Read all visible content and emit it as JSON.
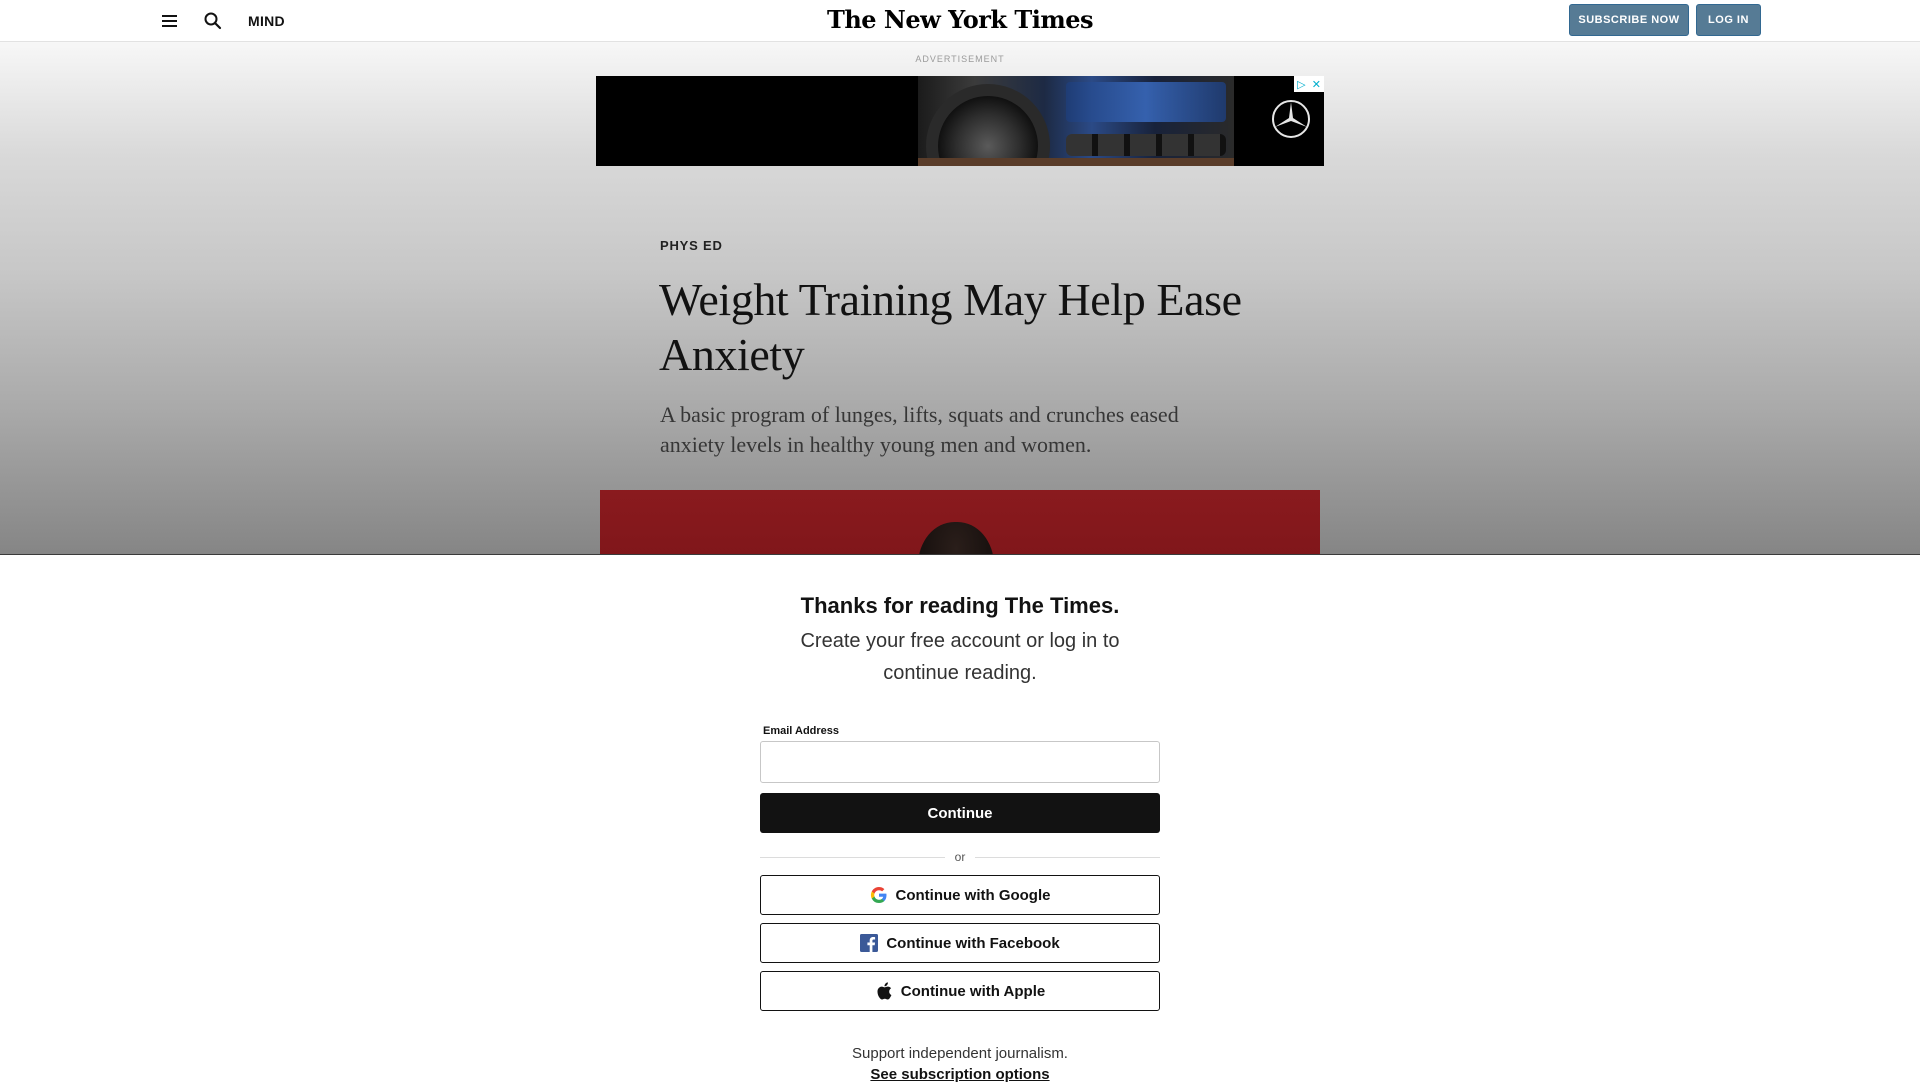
{
  "header": {
    "section": "MIND",
    "masthead": "The New York Times",
    "subscribe_label": "SUBSCRIBE NOW",
    "login_label": "LOG IN"
  },
  "ad": {
    "label": "ADVERTISEMENT"
  },
  "article": {
    "kicker": "PHYS ED",
    "headline": "Weight Training May Help Ease Anxiety",
    "summary": "A basic program of lunges, lifts, squats and crunches eased anxiety levels in healthy young men and women."
  },
  "regwall": {
    "title": "Thanks for reading The Times.",
    "subtitle": "Create your free account or log in to continue reading.",
    "email_label": "Email Address",
    "email_value": "",
    "continue_label": "Continue",
    "or_label": "or",
    "google_label": "Continue with Google",
    "facebook_label": "Continue with Facebook",
    "apple_label": "Continue with Apple",
    "support_text": "Support independent journalism.",
    "subscription_link": "See subscription options"
  },
  "colors": {
    "subscribe_button": "#567b95",
    "continue_button": "#121212",
    "hero_background": "#8a1a1e",
    "facebook_blue": "#3b5998"
  }
}
